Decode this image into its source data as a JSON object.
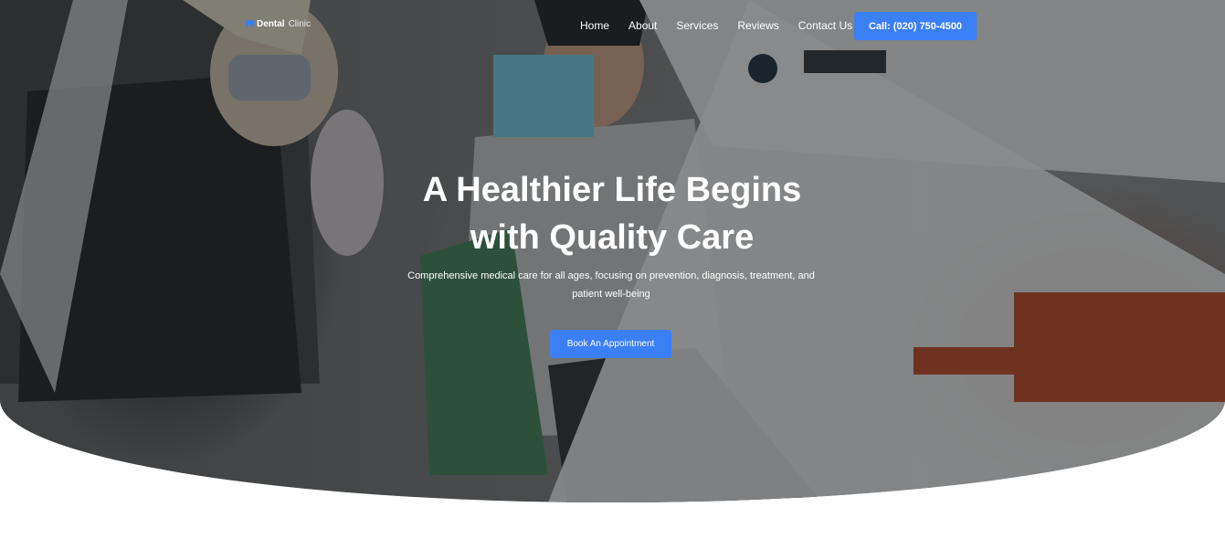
{
  "brand": {
    "name_bold": "Dental",
    "name_light": "Clinic",
    "icon": "tooth-icon",
    "accent_color": "#3b7ff5"
  },
  "nav": {
    "items": [
      {
        "label": "Home"
      },
      {
        "label": "About"
      },
      {
        "label": "Services"
      },
      {
        "label": "Reviews"
      },
      {
        "label": "Contact Us"
      }
    ],
    "call_button": "Call: (020) 750-4500"
  },
  "hero": {
    "title_line1": "A Healthier Life Begins",
    "title_line2": "with Quality Care",
    "subtitle_line1": "Comprehensive medical care for all ages, focusing on prevention, diagnosis, treatment, and",
    "subtitle_line2": "patient well-being",
    "cta": "Book An Appointment"
  }
}
